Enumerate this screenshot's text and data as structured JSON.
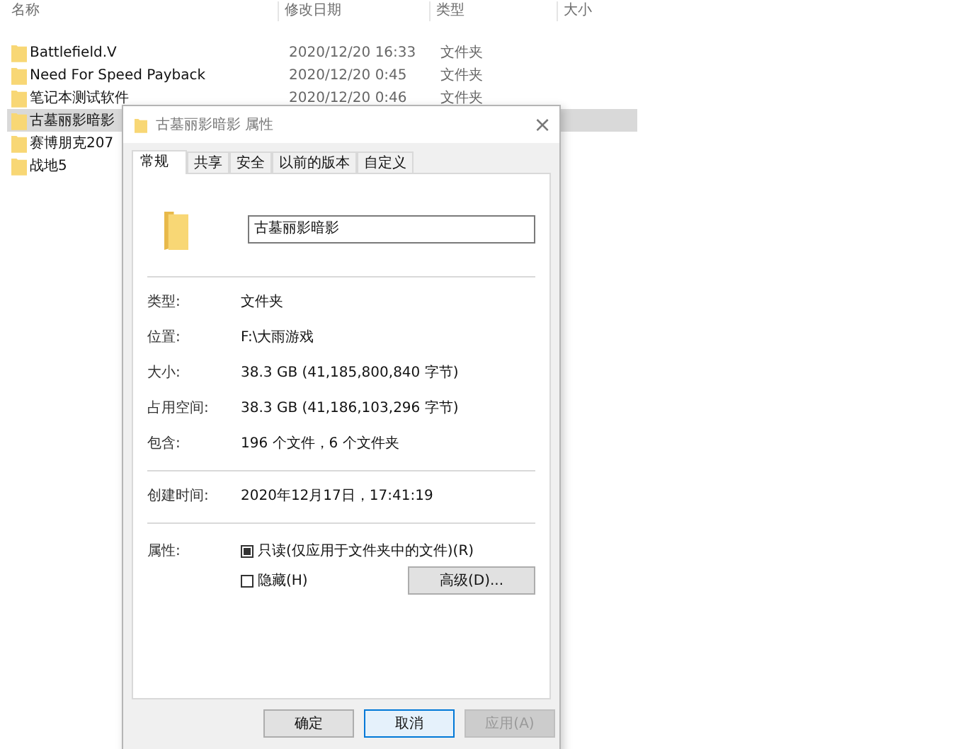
{
  "explorer": {
    "columns": [
      "名称",
      "修改日期",
      "类型",
      "大小"
    ],
    "rows": [
      {
        "name": "Battlefield.V",
        "date": "2020/12/20 16:33",
        "type": "文件夹",
        "selected": false
      },
      {
        "name": "Need For Speed Payback",
        "date": "2020/12/20 0:45",
        "type": "文件夹",
        "selected": false
      },
      {
        "name": "笔记本测试软件",
        "date": "2020/12/20 0:46",
        "type": "文件夹",
        "selected": false
      },
      {
        "name": "古墓丽影暗影",
        "selected": true
      },
      {
        "name": "赛博朋克207",
        "selected": false
      },
      {
        "name": "战地5",
        "selected": false
      }
    ]
  },
  "dialog": {
    "title": "古墓丽影暗影 属性",
    "close": "×",
    "tabs": [
      {
        "label": "常规",
        "selected": true
      },
      {
        "label": "共享",
        "selected": false
      },
      {
        "label": "安全",
        "selected": false
      },
      {
        "label": "以前的版本",
        "selected": false
      },
      {
        "label": "自定义",
        "selected": false
      }
    ],
    "name_field": {
      "value": "古墓丽影暗影"
    },
    "sections": [
      [
        {
          "label": "类型:",
          "value": "文件夹"
        },
        {
          "label": "位置:",
          "value": "F:\\大雨游戏"
        },
        {
          "label": "大小:",
          "value": "38.3 GB (41,185,800,840 字节)"
        },
        {
          "label": "占用空间:",
          "value": "38.3 GB (41,186,103,296 字节)"
        },
        {
          "label": "包含:",
          "value": "196 个文件，6 个文件夹"
        }
      ],
      [
        {
          "label": "创建时间:",
          "value": "2020年12月17日，17:41:19"
        }
      ]
    ],
    "attributes": {
      "label": "属性:",
      "checkboxes": [
        {
          "label": "只读(仅应用于文件夹中的文件)(R)",
          "mixed": true
        },
        {
          "label": "隐藏(H)",
          "mixed": false
        }
      ],
      "advanced_button": "高级(D)..."
    },
    "buttons": [
      {
        "label": "确定",
        "focused": false,
        "disabled": false
      },
      {
        "label": "取消",
        "focused": true,
        "disabled": false
      },
      {
        "label": "应用(A)",
        "focused": false,
        "disabled": true
      }
    ]
  }
}
